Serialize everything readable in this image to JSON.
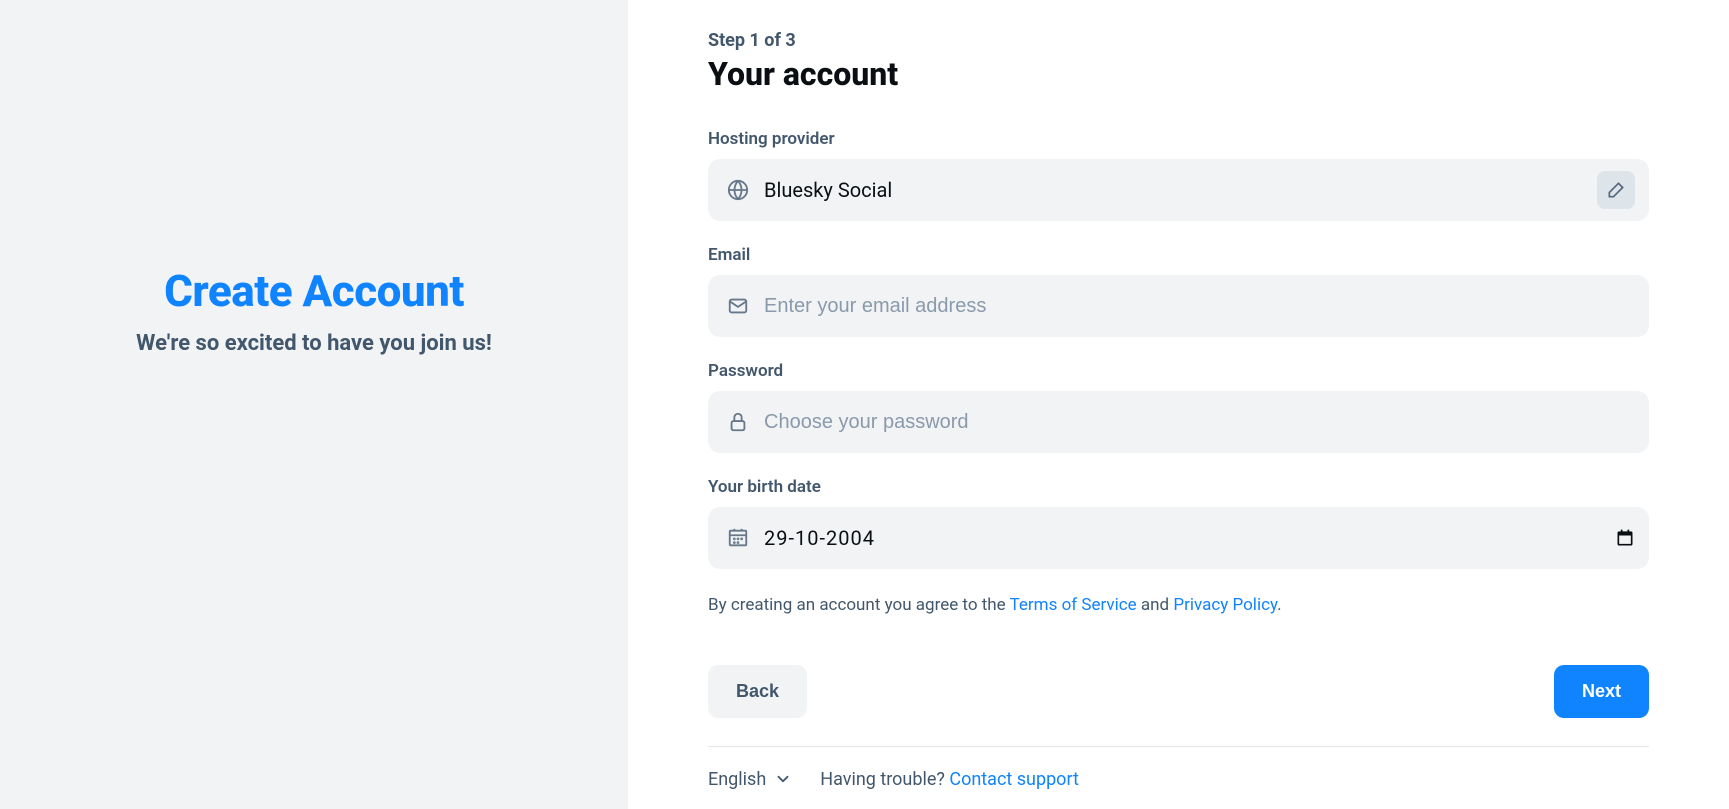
{
  "left": {
    "title": "Create Account",
    "subtitle": "We're so excited to have you join us!"
  },
  "form": {
    "step": "Step 1 of 3",
    "title": "Your account",
    "hosting_label": "Hosting provider",
    "hosting_value": "Bluesky Social",
    "email_label": "Email",
    "email_placeholder": "Enter your email address",
    "password_label": "Password",
    "password_placeholder": "Choose your password",
    "birth_label": "Your birth date",
    "birth_value": "29-10-2004",
    "terms_prefix": "By creating an account you agree to the ",
    "terms_tos": "Terms of Service",
    "terms_and": " and ",
    "terms_privacy": "Privacy Policy",
    "terms_suffix": "."
  },
  "buttons": {
    "back": "Back",
    "next": "Next"
  },
  "footer": {
    "language": "English",
    "trouble_prefix": "Having trouble? ",
    "contact": "Contact support"
  }
}
